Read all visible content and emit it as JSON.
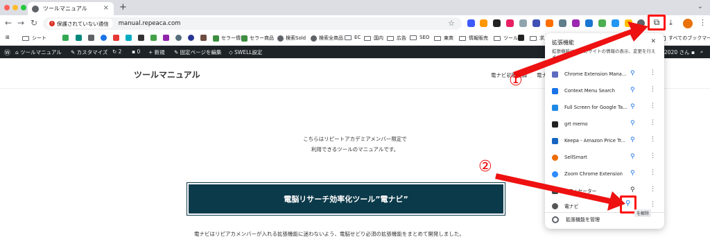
{
  "browser": {
    "tab_title": "ツールマニュアル",
    "new_tab": "+",
    "omnibox": {
      "security_warning": "保護されていない通信",
      "url": "manual.repeaca.com"
    }
  },
  "bookmarks": [
    {
      "label": "シート",
      "type": "folder"
    },
    {
      "label": "セラー情報",
      "type": "link",
      "color": "#3e8e41"
    },
    {
      "label": "セラー商品",
      "type": "link",
      "color": "#3e8e41"
    },
    {
      "label": "検索Sold",
      "type": "link",
      "color": "#5f6368"
    },
    {
      "label": "検索全商品",
      "type": "link",
      "color": "#5f6368"
    },
    {
      "label": "EC",
      "type": "folder"
    },
    {
      "label": "国内",
      "type": "folder"
    },
    {
      "label": "広告",
      "type": "folder"
    },
    {
      "label": "SEO",
      "type": "folder"
    },
    {
      "label": "東商",
      "type": "folder"
    },
    {
      "label": "情報販売",
      "type": "folder"
    },
    {
      "label": "ツール",
      "type": "folder"
    },
    {
      "label": "求人・",
      "type": "folder"
    },
    {
      "label": "すべてのブックマーク",
      "type": "folder"
    }
  ],
  "wp_admin": {
    "site": "ツールマニュアル",
    "customize": "カスタマイズ",
    "updates": "2",
    "comments": "0",
    "new": "新規",
    "edit": "固定ページを編集",
    "swell": "SWELL設定",
    "user": "2020 さん"
  },
  "site": {
    "title": "ツールマニュアル",
    "nav": [
      "電ナビ初期登録",
      "電ナ"
    ],
    "intro_line1": "こちらはリピートアカデミアメンバー限定で",
    "intro_line2": "利用できるツールのマニュアルです。",
    "heading": "電脳リサーチ効率化ツール”電ナビ”",
    "body": "電ナビはリピアカメンバーが入れる拡張機能に迷わないよう、電脳せどり必須の拡張機能をまとめて開発しました。"
  },
  "extensions_popup": {
    "title": "拡張機能",
    "subtitle": "拡張機能は、このサイトの情報の表示、変更を行えません。",
    "items": [
      {
        "name": "Chrome Extension Mana...",
        "color": "#5c6bc0",
        "pinned": false
      },
      {
        "name": "Context Menu Search",
        "color": "#1a73e8",
        "pinned": false
      },
      {
        "name": "Full Screen for Google Ta...",
        "color": "#1e88e5",
        "pinned": false
      },
      {
        "name": "grt memo",
        "color": "#222222",
        "pinned": false
      },
      {
        "name": "Keepa - Amazon Price Tr...",
        "color": "#1565c0",
        "pinned": false
      },
      {
        "name": "SellSmart",
        "color": "#ef6c00",
        "pinned": false
      },
      {
        "name": "Zoom Chrome Extension",
        "color": "#2d8cff",
        "pinned": false
      },
      {
        "name": "メモ+セーター",
        "color": "#444444",
        "pinned": true
      },
      {
        "name": "電ナビ",
        "color": "#555555",
        "pinned": false
      }
    ],
    "tooltip": "を解除",
    "manage": "拡張機能を管理"
  },
  "annotations": {
    "step1": "①",
    "step2": "②",
    "color": "#ee1111"
  }
}
